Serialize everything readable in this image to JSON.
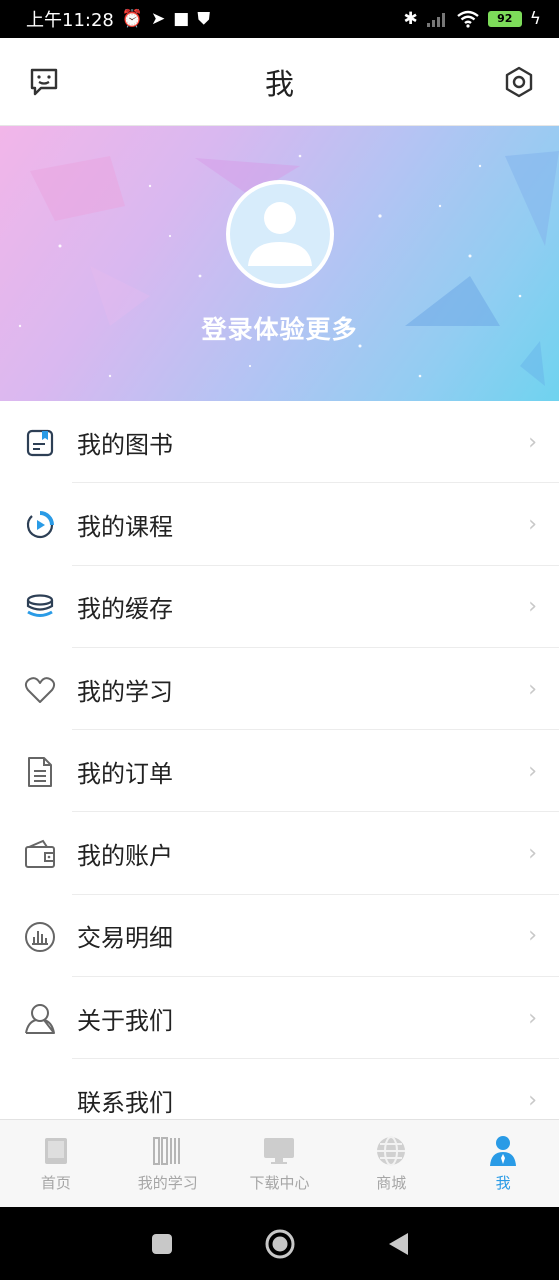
{
  "status": {
    "time": "上午11:28",
    "battery": "92"
  },
  "header": {
    "title": "我"
  },
  "profile": {
    "login_text": "登录体验更多"
  },
  "menu": [
    {
      "label": "我的图书",
      "icon": "book-icon"
    },
    {
      "label": "我的课程",
      "icon": "course-play-icon"
    },
    {
      "label": "我的缓存",
      "icon": "cache-stack-icon"
    },
    {
      "label": "我的学习",
      "icon": "heart-icon"
    },
    {
      "label": "我的订单",
      "icon": "order-document-icon"
    },
    {
      "label": "我的账户",
      "icon": "wallet-icon"
    },
    {
      "label": "交易明细",
      "icon": "chart-circle-icon"
    },
    {
      "label": "关于我们",
      "icon": "user-outline-icon"
    },
    {
      "label": "联系我们",
      "icon": ""
    }
  ],
  "tabs": [
    {
      "label": "首页",
      "icon": "home-book-icon"
    },
    {
      "label": "我的学习",
      "icon": "bookshelf-icon"
    },
    {
      "label": "下载中心",
      "icon": "monitor-icon"
    },
    {
      "label": "商城",
      "icon": "globe-icon"
    },
    {
      "label": "我",
      "icon": "person-icon",
      "active": true
    }
  ],
  "colors": {
    "accent": "#2a9be6",
    "inactive": "#a6a6a6"
  }
}
